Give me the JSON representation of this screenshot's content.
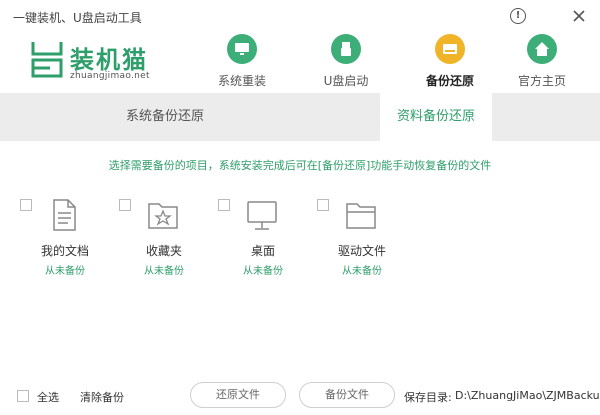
{
  "window": {
    "title": "一键装机、U盘启动工具"
  },
  "logo": {
    "brand": "装机猫",
    "domain": "zhuangjimao.net"
  },
  "nav": [
    {
      "label": "系统重装",
      "icon": "monitor-icon",
      "color": "#3dae78",
      "active": false
    },
    {
      "label": "U盘启动",
      "icon": "usb-icon",
      "color": "#3dae78",
      "active": false
    },
    {
      "label": "备份还原",
      "icon": "backup-disk-icon",
      "color": "#f0b429",
      "active": true
    },
    {
      "label": "官方主页",
      "icon": "home-icon",
      "color": "#3dae78",
      "active": false
    }
  ],
  "subtabs": {
    "system": "系统备份还原",
    "data": "资料备份还原"
  },
  "hint": "选择需要备份的项目，系统安装完成后可在[备份还原]功能手动恢复备份的文件",
  "items": [
    {
      "name": "我的文档",
      "status": "从未备份",
      "icon": "document-icon"
    },
    {
      "name": "收藏夹",
      "status": "从未备份",
      "icon": "favorites-folder-icon"
    },
    {
      "name": "桌面",
      "status": "从未备份",
      "icon": "desktop-monitor-icon"
    },
    {
      "name": "驱动文件",
      "status": "从未备份",
      "icon": "driver-folder-icon"
    }
  ],
  "footer": {
    "select_all": "全选",
    "clear": "清除备份",
    "restore": "还原文件",
    "backup": "备份文件",
    "path_label": "保存目录:",
    "path": "D:\\ZhuangJiMao\\ZJMBackup"
  },
  "colors": {
    "accent": "#2e9e6a",
    "nav_green": "#3dae78",
    "nav_active": "#f0b429"
  }
}
